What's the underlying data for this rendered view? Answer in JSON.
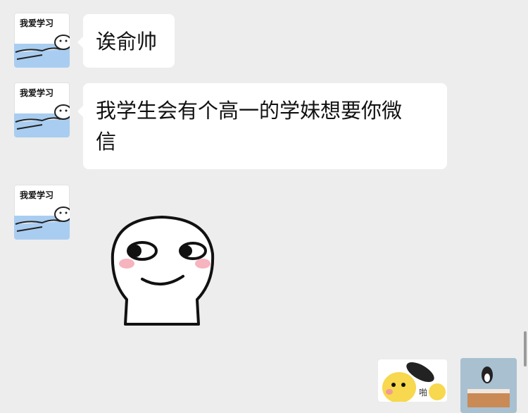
{
  "messages": [
    {
      "sender_caption": "我爱学习",
      "text": "诶俞帅"
    },
    {
      "sender_caption": "我爱学习",
      "text_line1": "我学生会有个高一的学妹想要你微",
      "text_line2": "信"
    },
    {
      "sender_caption": "我爱学习",
      "sticker": "smirk-face-sticker"
    }
  ],
  "bottom_thumbnails": [
    {
      "icon": "duck-pan-sticker",
      "caption": "啪"
    },
    {
      "icon": "penguin-bed-photo"
    }
  ]
}
